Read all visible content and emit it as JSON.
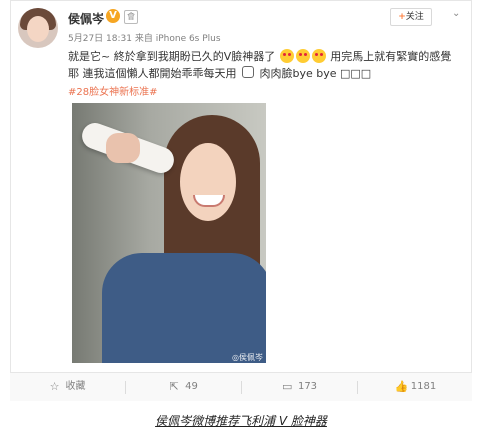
{
  "post": {
    "author": "侯佩岑",
    "verified_badge": "V",
    "member_icon": "會",
    "date": "5月27日 18:31",
    "source": "来自 iPhone 6s Plus",
    "follow_label": "关注",
    "follow_plus": "+",
    "dropdown_icon": "⌄",
    "text_part1": "就是它~ 終於拿到我期盼已久的V臉神器了",
    "text_part2": "用完馬上就有緊實的感覺耶 連我這個懶人都開始乖乖每天用",
    "text_part3": "肉肉臉bye bye □□□",
    "hashtag": "#28脸女神新标准#",
    "photo_watermark": "◎侯佩岑"
  },
  "actions": {
    "favorite_label": "收藏",
    "repost_count": "49",
    "comment_count": "173",
    "like_count": "1181"
  },
  "caption": "侯佩岑微博推荐飞利浦 V 脸神器",
  "colors": {
    "accent": "#eb7350",
    "follow_plus": "#ff8140",
    "badge": "#f6a623"
  }
}
